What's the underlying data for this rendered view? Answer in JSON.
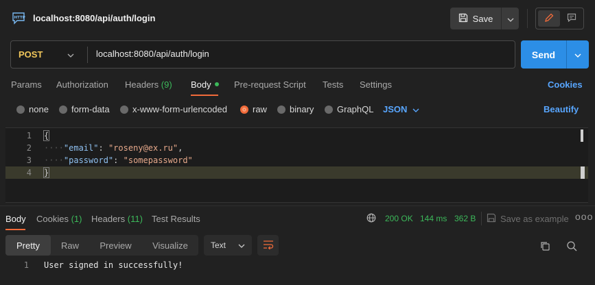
{
  "header": {
    "icon": "http-icon",
    "title": "localhost:8080/api/auth/login",
    "save_label": "Save"
  },
  "request": {
    "method": "POST",
    "url": "localhost:8080/api/auth/login",
    "send_label": "Send",
    "method_color": "#f1c75b",
    "send_color": "#2c8ee6"
  },
  "request_tabs": {
    "params": "Params",
    "authorization": "Authorization",
    "headers": "Headers",
    "headers_count": "(9)",
    "body": "Body",
    "pre_request": "Pre-request Script",
    "tests": "Tests",
    "settings": "Settings",
    "cookies": "Cookies"
  },
  "body_types": {
    "none": "none",
    "form_data": "form-data",
    "urlencoded": "x-www-form-urlencoded",
    "raw": "raw",
    "binary": "binary",
    "graphql": "GraphQL",
    "selected": "raw",
    "language": "JSON",
    "beautify": "Beautify"
  },
  "editor": {
    "lines": [
      {
        "n": "1",
        "brace": "{"
      },
      {
        "n": "2",
        "key": "\"email\"",
        "value": "\"roseny@ex.ru\""
      },
      {
        "n": "3",
        "key": "\"password\"",
        "value": "\"somepassword\""
      },
      {
        "n": "4",
        "brace": "}"
      }
    ],
    "ws_dots": "····",
    "colon": ":",
    "comma": ","
  },
  "response_tabs": {
    "body": "Body",
    "cookies": "Cookies",
    "cookies_count": "(1)",
    "headers": "Headers",
    "headers_count": "(11)",
    "test_results": "Test Results"
  },
  "response_status": {
    "code": "200 OK",
    "time": "144 ms",
    "size": "362 B",
    "save_example": "Save as example",
    "more": "ooo",
    "accent_color": "#3cb95a"
  },
  "response_view": {
    "pretty": "Pretty",
    "raw": "Raw",
    "preview": "Preview",
    "visualize": "Visualize",
    "format": "Text"
  },
  "response_body": {
    "lines": [
      {
        "n": "1",
        "text": "User signed in successfully!"
      }
    ]
  }
}
